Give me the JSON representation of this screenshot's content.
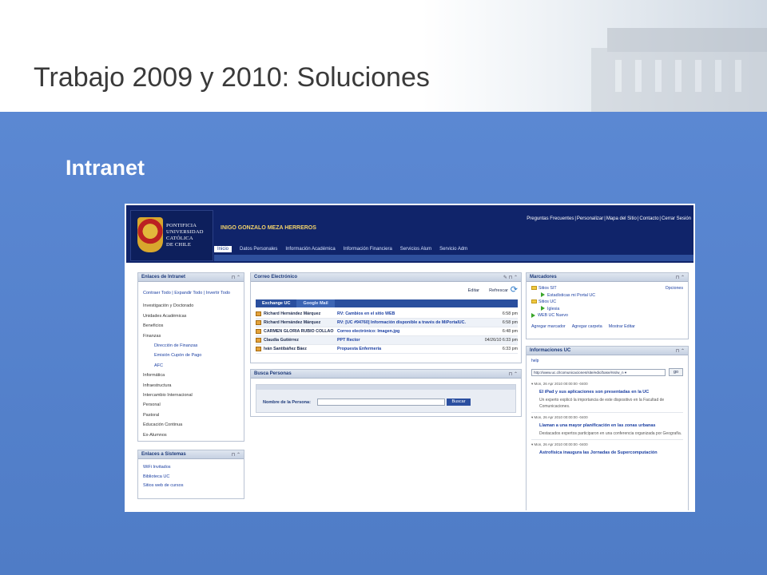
{
  "slide": {
    "title": "Trabajo 2009 y 2010: Soluciones",
    "subtitle": "Intranet"
  },
  "portal": {
    "university": [
      "Pontificia",
      "Universidad",
      "Católica",
      "de Chile"
    ],
    "user_name": "INIGO GONZALO MEZA HERREROS",
    "top_links": [
      "Preguntas Frecuentes",
      "Personalizar",
      "Mapa del Sitio",
      "Contacto",
      "Cerrar Sesión"
    ],
    "nav": [
      "Inicio",
      "Datos Personales",
      "Información Académica",
      "Información Financiera",
      "Servicios Alum",
      "Servicio Adm"
    ],
    "enlaces_intranet": {
      "title": "Enlaces de Intranet",
      "controls": "⊓ ⌃",
      "actions": "Contraer Todo | Expandir Todo | Invertir Todo",
      "items": [
        "Investigación y Doctorado",
        "Unidades Académicas",
        "Beneficios",
        "Finanzas"
      ],
      "finanzas_sub": [
        "Dirección de Finanzas",
        "Emisión Cupón de Pago",
        "AFC"
      ],
      "items_after": [
        "Informática",
        "Infraestructura",
        "Intercambio Internacional",
        "Personal",
        "Pastoral",
        "Educación Continua",
        "Ex-Alumnos"
      ]
    },
    "enlaces_sistemas": {
      "title": "Enlaces a Sistemas",
      "controls": "⊓ ⌃",
      "items": [
        "WiFi Invitados",
        "Biblioteca UC",
        "Sitios web de cursos"
      ]
    },
    "correo": {
      "title": "Correo Electrónico",
      "controls": "✎ ⊓ ⌃",
      "editar": "Editar",
      "refrescar": "Refrescar",
      "tabs": [
        "Exchange UC",
        "Google Mail"
      ],
      "rows": [
        {
          "from": "Richard Hernández Márquez",
          "subject": "RV: Cambios en el sitio WEB",
          "time": "6:58 pm"
        },
        {
          "from": "Richard Hernández Márquez",
          "subject": "RV: [UC #94760] Información disponible a través de MiPortalUC.",
          "time": "6:58 pm"
        },
        {
          "from": "CARMEN GLORIA RUBIO COLLAO",
          "subject": "Correo electrónico: Imagen.jpg",
          "time": "6:48 pm"
        },
        {
          "from": "Claudia Gutiérrez",
          "subject": "PPT Rector",
          "time": "04/26/10 6:33 pm"
        },
        {
          "from": "Iván Santibáñez Báez",
          "subject": "Propuesta Enfermería",
          "time": "6:33 pm"
        }
      ]
    },
    "busca": {
      "title": "Busca Personas",
      "controls": "⊓ ⌃",
      "label": "Nombre de la Persona:",
      "button": "Buscar"
    },
    "marcadores": {
      "title": "Marcadores",
      "controls": "⊓ ⌃",
      "opciones": "Opciones",
      "sitios_sit": "Sitios SIT",
      "sub1": "Estadísticas mi Portal UC",
      "sitios_uc": "Sitios UC",
      "sub2": "Iglesia",
      "sub3": "WEB UC Nuevo",
      "footer": [
        "Agregar marcador",
        "Agregar carpeta",
        "Mostrar Editar"
      ]
    },
    "informaciones": {
      "title": "Informaciones UC",
      "controls": "⊓ ⌃",
      "help": "help",
      "url": "http://www.uc.cl/comunicaciones/site/edic/base/rss/w_n",
      "go": "go",
      "news": [
        {
          "date": "Mon, 26 Apr 2010 00:00:00 -0400",
          "title": "El iPad y sus aplicaciones son presentadas en la UC",
          "body": "Un experto explicó la importancia de este dispositivo en la Facultad de Comunicaciones."
        },
        {
          "date": "Mon, 26 Apr 2010 00:00:00 -0400",
          "title": "Llaman a una mayor planificación en las zonas urbanas",
          "body": "Destacados expertos participaron en una conferencia organizada por Geografía."
        },
        {
          "date": "Mon, 26 Apr 2010 00:00:00 -0400",
          "title": "Astrofísica inaugura las Jornadas de Supercomputación",
          "body": ""
        }
      ]
    }
  }
}
